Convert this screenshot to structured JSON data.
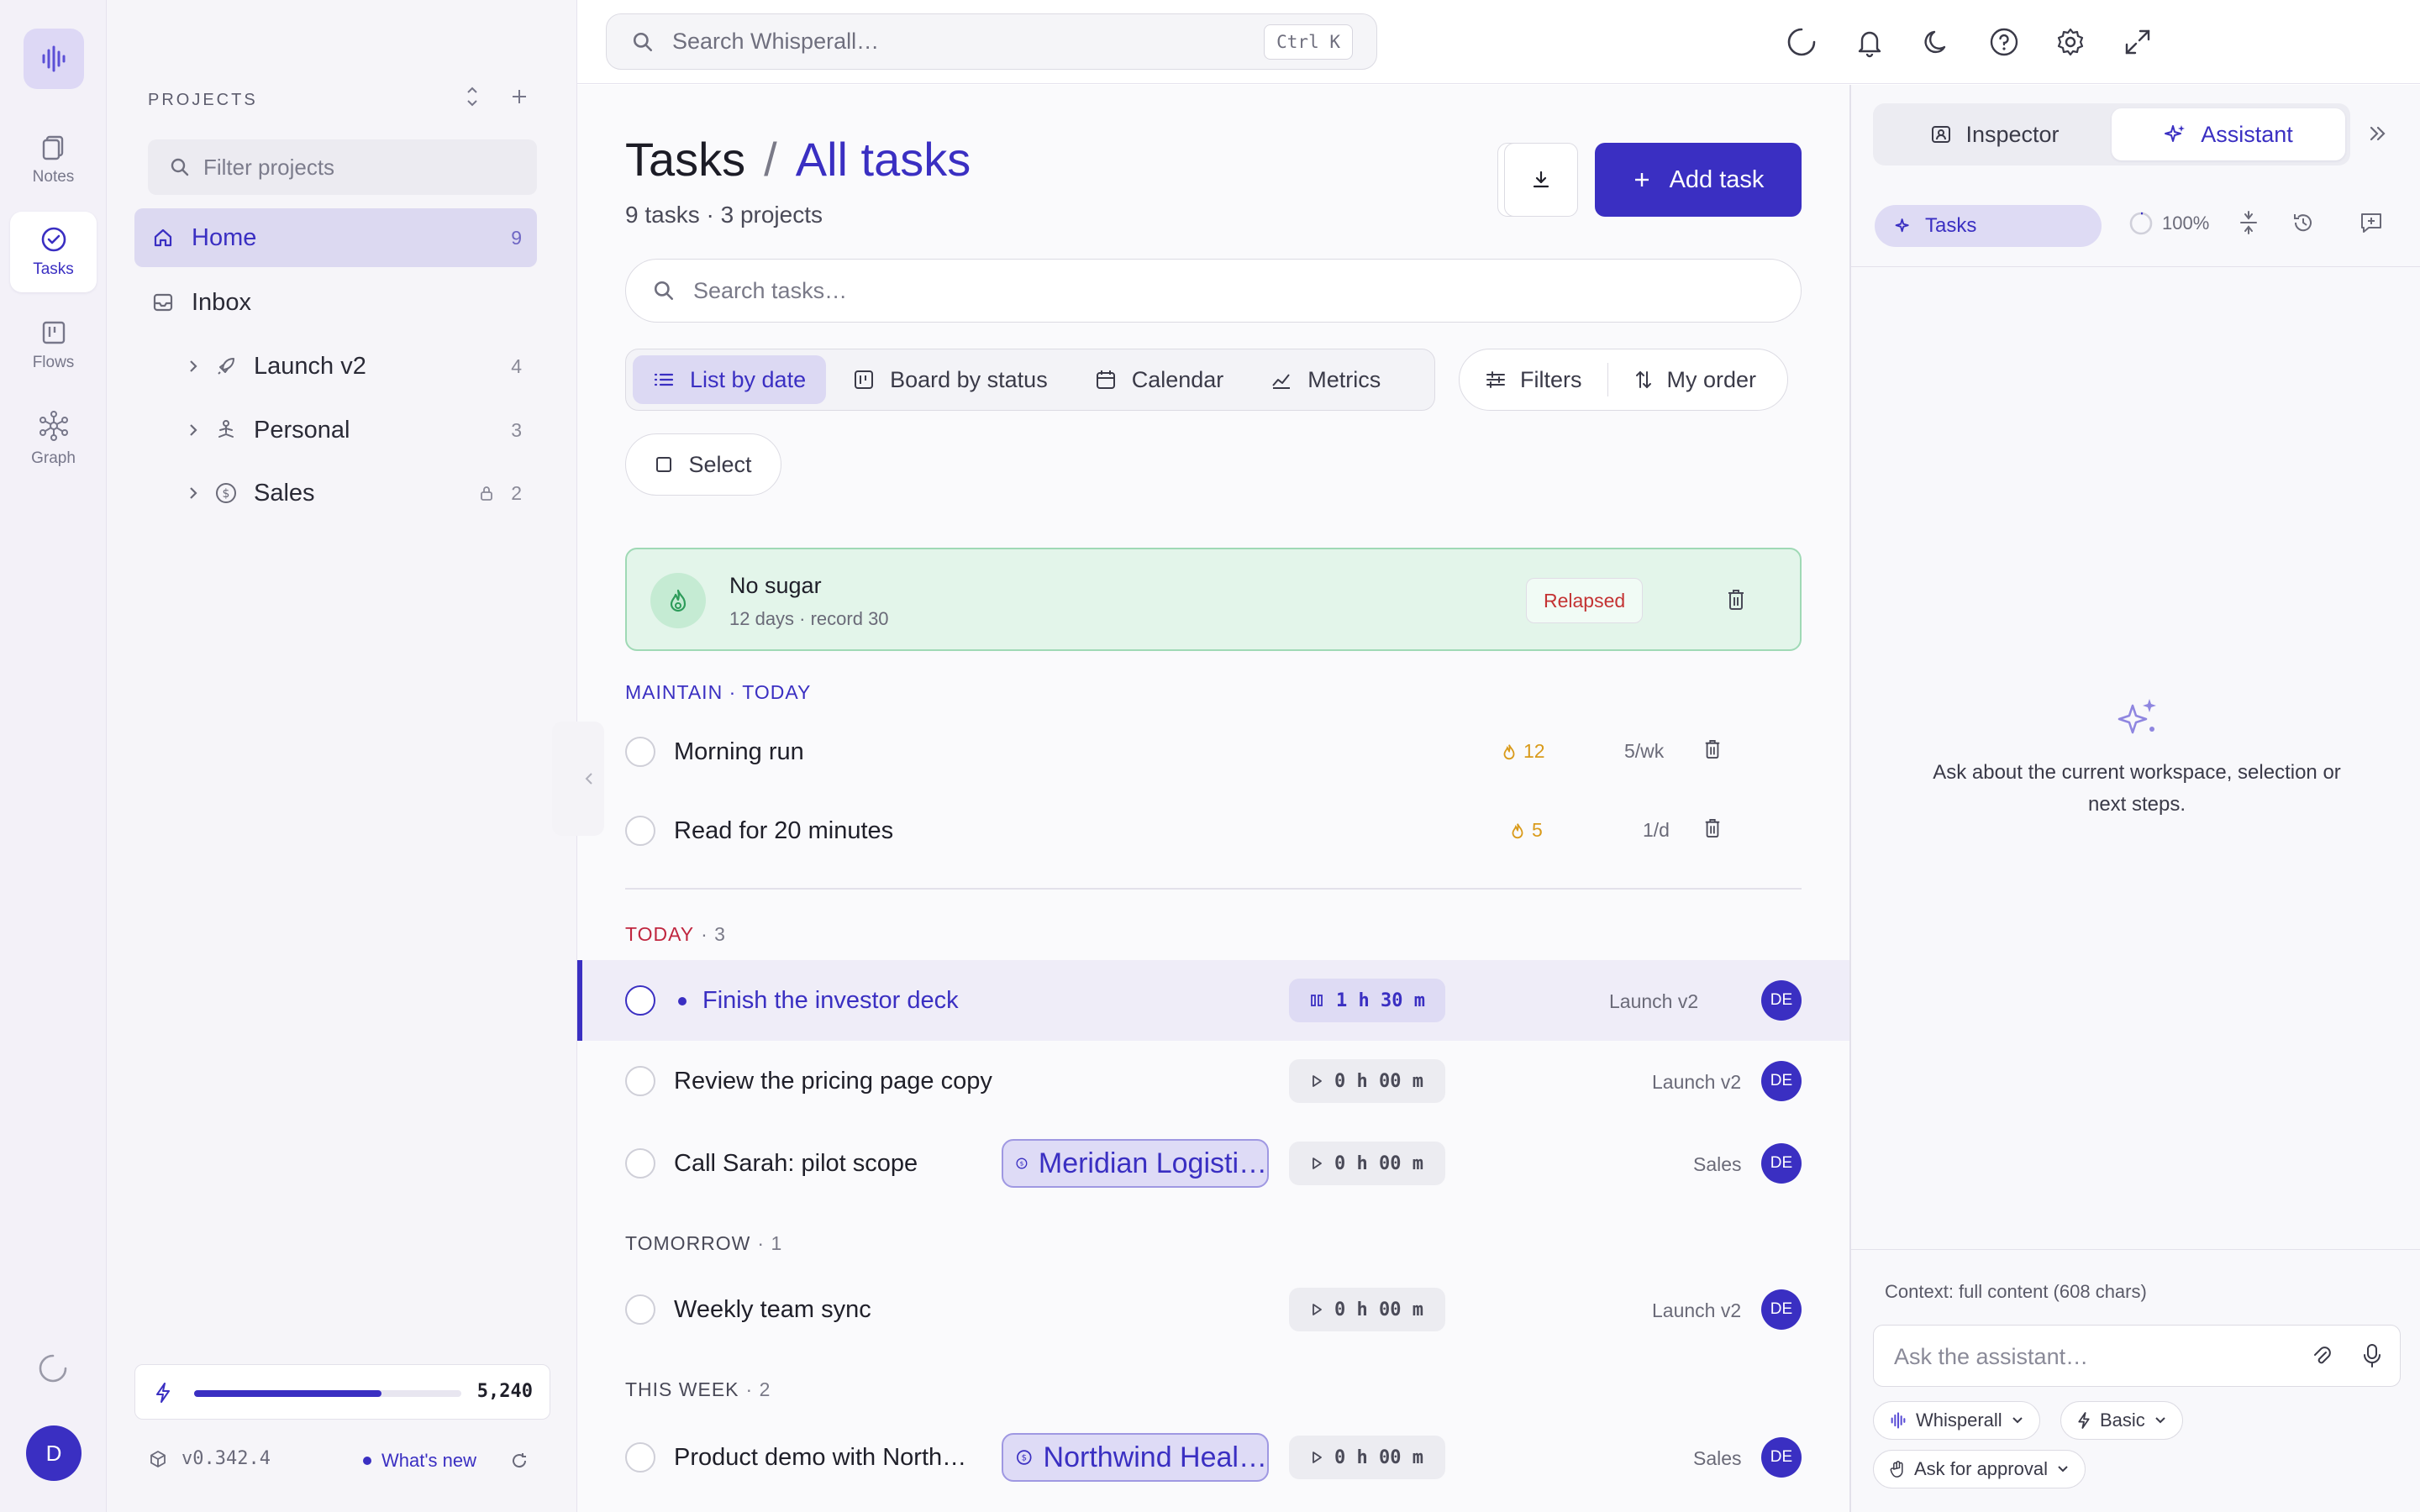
{
  "rail": {
    "items": [
      {
        "label": "Notes",
        "icon": "notes-icon"
      },
      {
        "label": "Tasks",
        "icon": "tasks-icon"
      },
      {
        "label": "Flows",
        "icon": "flows-icon"
      },
      {
        "label": "Graph",
        "icon": "graph-icon"
      }
    ],
    "avatar": "D"
  },
  "sidebar": {
    "heading": "PROJECTS",
    "filter_placeholder": "Filter projects",
    "items": [
      {
        "label": "Home",
        "count": "9"
      },
      {
        "label": "Inbox",
        "count": ""
      },
      {
        "label": "Launch v2",
        "count": "4"
      },
      {
        "label": "Personal",
        "count": "3"
      },
      {
        "label": "Sales",
        "count": "2"
      }
    ],
    "credits": {
      "value": "5,240",
      "fill_fraction": 0.7
    },
    "version": "v0.342.4",
    "whats_new": "What's new"
  },
  "topbar": {
    "search_placeholder": "Search Whisperall…",
    "shortcut": "Ctrl K"
  },
  "main": {
    "title": "Tasks",
    "separator": "/",
    "crumb": "All tasks",
    "subtitle": "9 tasks · 3 projects",
    "add_task": "Add task",
    "search_placeholder": "Search tasks…",
    "views": [
      "List by date",
      "Board by status",
      "Calendar",
      "Metrics"
    ],
    "filters": "Filters",
    "order": "My order",
    "select": "Select",
    "habit": {
      "title": "No sugar",
      "sub": "12 days · record 30",
      "status": "Relapsed"
    },
    "maintain": {
      "label": "MAINTAIN · TODAY",
      "items": [
        {
          "title": "Morning run",
          "streak": "12",
          "freq": "5/wk"
        },
        {
          "title": "Read for 20 minutes",
          "streak": "5",
          "freq": "1/d"
        }
      ]
    },
    "sections": [
      {
        "label": "TODAY",
        "count": "· 3",
        "tasks": [
          {
            "title": "Finish the investor deck",
            "timer": "1 h 30 m",
            "project": "Launch v2",
            "assignee": "DE"
          },
          {
            "title": "Review the pricing page copy",
            "timer": "0 h 00 m",
            "project": "Launch v2",
            "assignee": "DE"
          },
          {
            "title": "Call Sarah: pilot scope",
            "tag": "Meridian Logisti…",
            "timer": "0 h 00 m",
            "project": "Sales",
            "assignee": "DE"
          }
        ]
      },
      {
        "label": "TOMORROW",
        "count": "· 1",
        "tasks": [
          {
            "title": "Weekly team sync",
            "timer": "0 h 00 m",
            "project": "Launch v2",
            "assignee": "DE"
          }
        ]
      },
      {
        "label": "THIS WEEK",
        "count": "· 2",
        "tasks": [
          {
            "title": "Product demo with North…",
            "tag": "Northwind Heal…",
            "timer": "0 h 00 m",
            "project": "Sales",
            "assignee": "DE"
          }
        ]
      }
    ]
  },
  "assistant": {
    "tabs": [
      "Inspector",
      "Assistant"
    ],
    "scope": "Tasks",
    "zoom": "100%",
    "empty_text": "Ask about the current workspace, selection or next steps.",
    "context": "Context: full content (608 chars)",
    "ask_placeholder": "Ask the assistant…",
    "model": "Whisperall",
    "mode": "Basic",
    "approval": "Ask for approval"
  },
  "colors": {
    "accent": "#3a2fc2",
    "habit_bg": "#e3f5ea",
    "today_label": "#c0263f",
    "relapsed": "#c43333",
    "streak": "#d99a1a"
  }
}
